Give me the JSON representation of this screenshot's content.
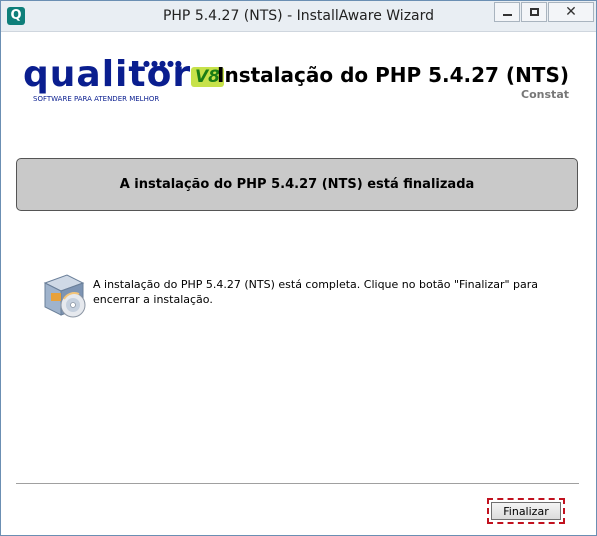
{
  "window": {
    "title": "PHP 5.4.27 (NTS) - InstallAware Wizard",
    "app_icon_glyph": "Q",
    "close_glyph": "✕"
  },
  "logo": {
    "text": "qualitor",
    "version": "V8",
    "tagline": "SOFTWARE PARA ATENDER MELHOR",
    "brand_color": "#0a1e8f",
    "version_color": "#1a7d15"
  },
  "header": {
    "title": "Instalação do PHP 5.4.27 (NTS)",
    "company": "Constat"
  },
  "status": {
    "heading": "A instalação do PHP 5.4.27 (NTS) está finalizada",
    "panel_color": "#c9c9c9"
  },
  "main": {
    "icon": "install-package-icon",
    "message": "A instalação do PHP 5.4.27 (NTS) está completa. Clique no botão \"Finalizar\" para encerrar a instalação."
  },
  "footer": {
    "finish_label": "Finalizar",
    "focus_color": "#c1121f"
  }
}
